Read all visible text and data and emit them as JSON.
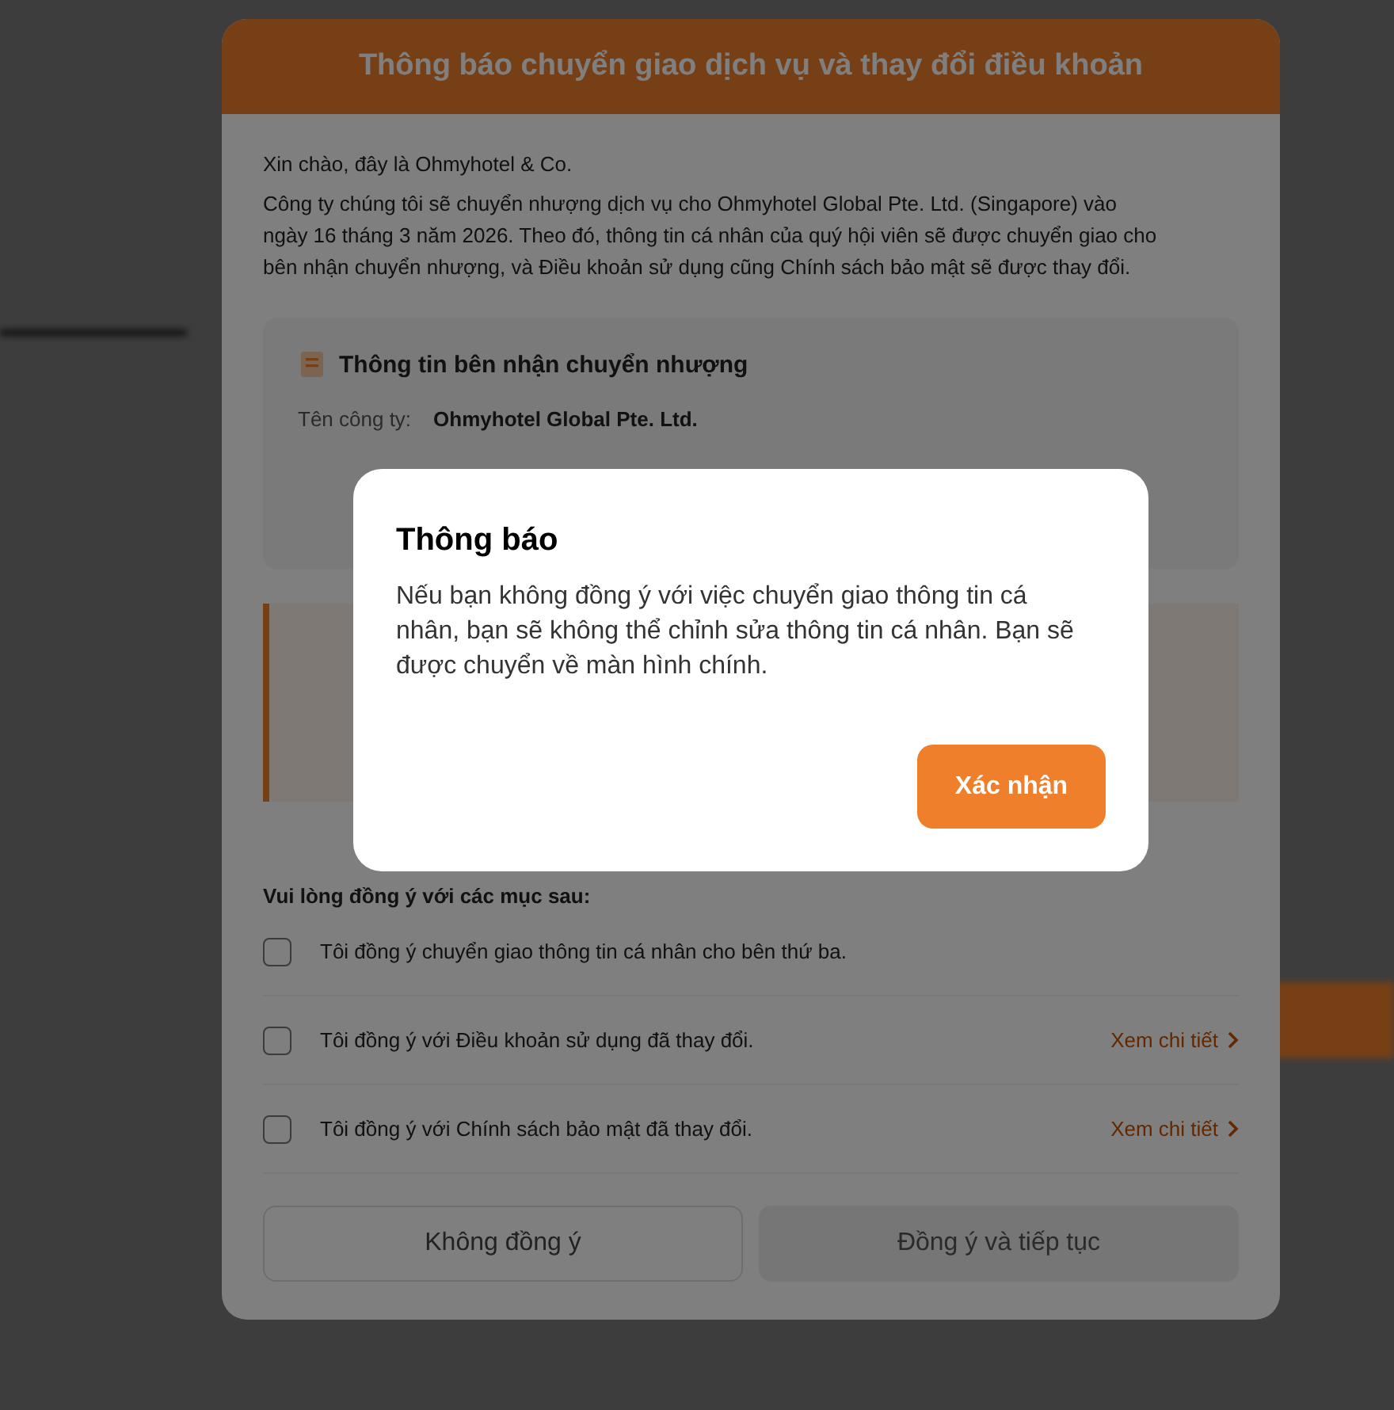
{
  "background_dialog": {
    "title": "Thông báo chuyển giao dịch vụ và thay đổi điều khoản",
    "greeting": "Xin chào, đây là Ohmyhotel & Co.",
    "intro": "Công ty chúng tôi sẽ chuyển nhượng dịch vụ cho Ohmyhotel Global Pte. Ltd. (Singapore) vào ngày 16 tháng 3 năm 2026. Theo đó, thông tin cá nhân của quý hội viên sẽ được chuyển giao cho bên nhận chuyển nhượng, và Điều khoản sử dụng cũng Chính sách bảo mật sẽ được thay đổi.",
    "recipient": {
      "title": "Thông tin bên nhận chuyển nhượng",
      "label": "Tên công ty:",
      "value": "Ohmyhotel Global Pte. Ltd."
    },
    "consent_heading": "Vui lòng đồng ý với các mục sau:",
    "consents": [
      {
        "label": "Tôi đồng ý chuyển giao thông tin cá nhân cho bên thứ ba.",
        "checked": false
      },
      {
        "label": "Tôi đồng ý với Điều khoản sử dụng đã thay đổi.",
        "checked": false,
        "link": "Xem chi tiết"
      },
      {
        "label": "Tôi đồng ý với Chính sách bảo mật đã thay đổi.",
        "checked": false,
        "link": "Xem chi tiết"
      }
    ],
    "buttons": [
      {
        "label": "Không đồng ý",
        "kind": "outline"
      },
      {
        "label": "Đồng ý và tiếp tục",
        "kind": "filled"
      }
    ]
  },
  "alert": {
    "title": "Thông báo",
    "message": "Nếu bạn không đồng ý với việc chuyển giao thông tin cá nhân, bạn sẽ không thể chỉnh sửa thông tin cá nhân. Bạn sẽ được chuyển về màn hình chính.",
    "button": "Xác nhận"
  }
}
